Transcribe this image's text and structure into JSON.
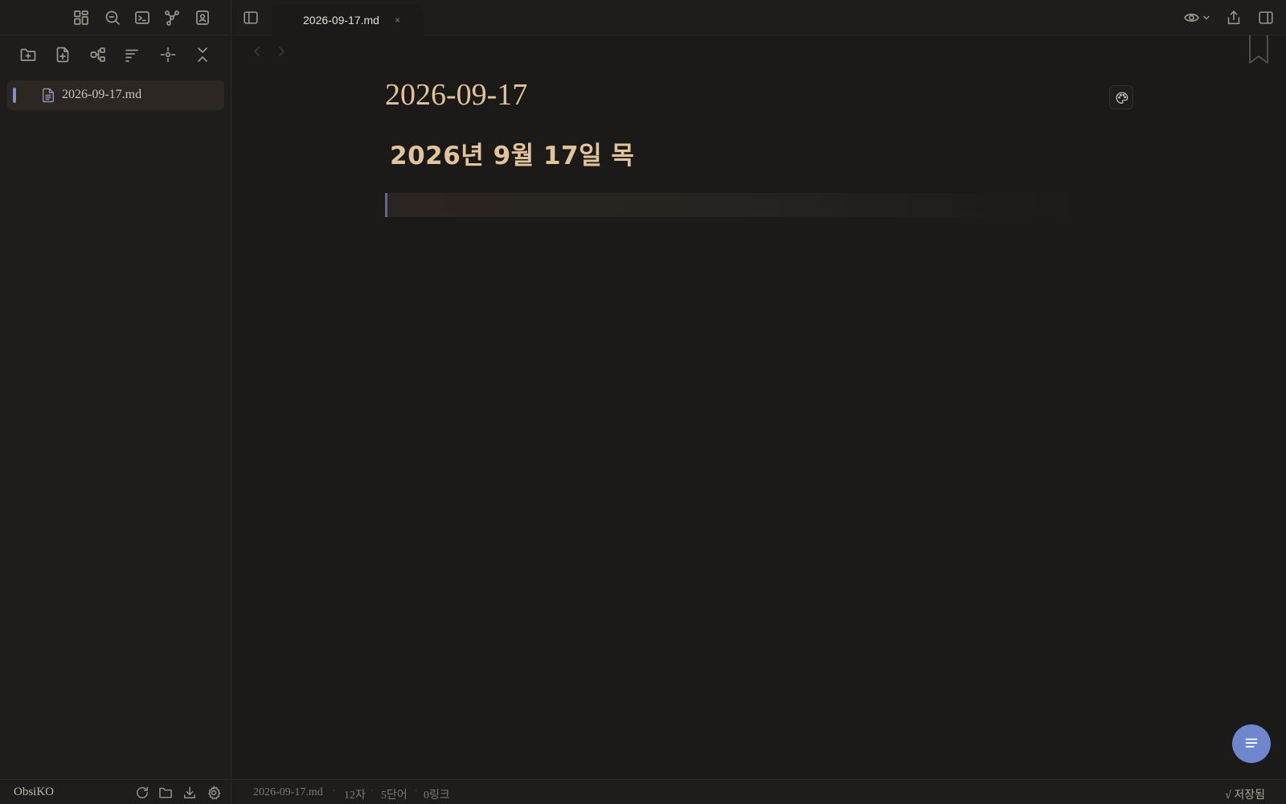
{
  "tab": {
    "label": "2026-09-17.md",
    "close": "×"
  },
  "sidebar": {
    "file": {
      "name": "2026-09-17.md"
    },
    "vault_name": "ObsiKO"
  },
  "note": {
    "title": "2026-09-17",
    "heading": "2026년 9월 17일 목"
  },
  "status": {
    "filename": "2026-09-17.md",
    "chars": "12자",
    "words": "5단어",
    "links": "0링크",
    "saved": "√ 저장됨"
  },
  "colors": {
    "accent": "#6d86cc",
    "heading": "#e2c49c",
    "background": "#1b1a19",
    "sidebar_bg": "#1e1d1c",
    "active_file_bg": "#2c2722"
  },
  "icons": {
    "ribbon": [
      "dashboard-icon",
      "search-icon",
      "terminal-icon",
      "graph-icon",
      "contact-icon"
    ],
    "explorer": [
      "new-folder-icon",
      "new-file-icon",
      "structure-icon",
      "sort-icon",
      "locate-icon",
      "collapse-icon"
    ],
    "footer": [
      "refresh-icon",
      "folder-icon",
      "download-icon",
      "settings-icon"
    ]
  }
}
